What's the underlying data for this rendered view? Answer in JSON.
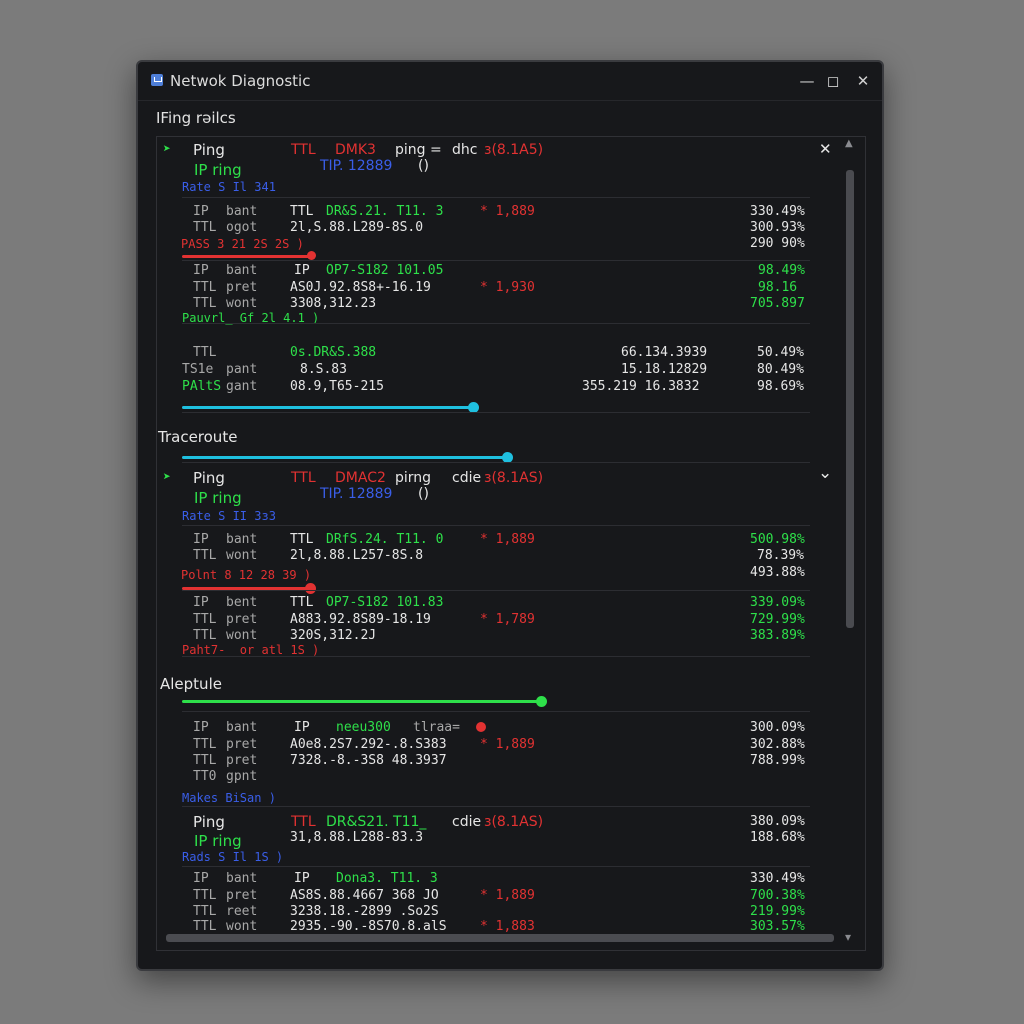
{
  "window": {
    "title": "Netwok Diagnostic",
    "minimize": "—",
    "maximize": "◻",
    "close": "✕"
  },
  "sections": {
    "ping_results": "IFing rəilcs",
    "traceroute": "Traceroute",
    "replies": "Aleptule"
  },
  "panel_controls": {
    "close": "✕",
    "expand": "⌄",
    "scroll_down": "▾"
  },
  "block1": {
    "header": {
      "label": "Ping",
      "ttl": "TTL",
      "dms": "DMK3",
      "ping": "ping =",
      "dhc": "dhc",
      "time": "ɜ(8.1A5)",
      "ip_ring": "IP ring",
      "tip": "TIP. 12889",
      "paren": "()",
      "rate": "Rate S Il 341"
    },
    "rows_a": [
      {
        "k": "IP",
        "s": "bant",
        "v1": "TTL",
        "v2": "DR&S.21. T11. 3",
        "v3": "* 1,889",
        "pct": "330.49%"
      },
      {
        "k": "TTL",
        "s": "ogot",
        "v1": "2l,S.88.L289-8S.0",
        "v2": "",
        "v3": "",
        "pct": "300.93%"
      }
    ],
    "bar_label_a": "PASS 3 21 2S 2S )",
    "pct_extra": "290 90%",
    "rows_b": [
      {
        "k": "IP",
        "s": "bant",
        "v1": "IP",
        "v2": "OP7-S182 101.05",
        "v3": "",
        "pct": "98.49%"
      },
      {
        "k": "TTL",
        "s": "pret",
        "v1": "AS0J.92.8S8+-16.19",
        "v2": "",
        "v3": "* 1,930",
        "pct": "98.16"
      },
      {
        "k": "TTL",
        "s": "wont",
        "v1": "3308,312.23",
        "v2": "",
        "v3": "",
        "pct": "705.897"
      }
    ],
    "bar_label_b": "Pauvrl_ Gf 2l 4.1 )"
  },
  "block2": {
    "rows": [
      {
        "k": "TTL",
        "s": "",
        "v1": "0s.DR&S.388",
        "mid": "66.134.3939",
        "pct": "50.49%"
      },
      {
        "k": "TS1e",
        "s": "pant",
        "v1": "8.S.83",
        "mid": "15.18.12829",
        "pct": "80.49%"
      },
      {
        "k": "PAltS",
        "s": "gant",
        "v1": "08.9,T65-215",
        "mid": "355.219 16.3832",
        "pct": "98.69%"
      }
    ]
  },
  "block3": {
    "header": {
      "label": "Ping",
      "ttl": "TTL",
      "dms": "DMAC2",
      "ping": "pirng",
      "dhc": "cdie",
      "time": "ɜ(8.1AS)",
      "ip_ring": "IP ring",
      "tip": "TIP. 12889",
      "paren": "()",
      "rate": "Rate S II 3ɜ3"
    },
    "rows_a": [
      {
        "k": "IP",
        "s": "bant",
        "v1": "TTL",
        "v2": "DRfS.24. T11. 0",
        "v3": "* 1,889",
        "pct": "500.98%"
      },
      {
        "k": "TTL",
        "s": "wont",
        "v1": "2l,8.88.L257-8S.8",
        "v2": "",
        "v3": "",
        "pct": "78.39%"
      }
    ],
    "bar_label_a": "Polnt 8 12 28 39 )",
    "pct_extra": "493.88%",
    "rows_b": [
      {
        "k": "IP",
        "s": "bent",
        "v1": "TTL",
        "v2": "OP7-S182 101.83",
        "v3": "",
        "pct": "339.09%"
      },
      {
        "k": "TTL",
        "s": "pret",
        "v1": "A883.92.8S89-18.19",
        "v2": "",
        "v3": "* 1,789",
        "pct": "729.99%"
      },
      {
        "k": "TTL",
        "s": "wont",
        "v1": "320S,312.2J",
        "v2": "",
        "v3": "",
        "pct": "383.89%"
      }
    ],
    "bar_label_b": "Paht7-_ or atl 1S )"
  },
  "block4": {
    "rows": [
      {
        "k": "IP",
        "s": "bant",
        "v1": "IP",
        "v2": "neeu300",
        "v3": "tlraa=",
        "pct": "300.09%"
      },
      {
        "k": "TTL",
        "s": "pret",
        "v1": "A0e8.2S7.292-.8.S383",
        "v2": "",
        "v3": "* 1,889",
        "pct": "302.88%"
      },
      {
        "k": "TTL",
        "s": "pret",
        "v1": "7328.-8.-3S8 48.3937",
        "v2": "",
        "v3": "",
        "pct": "788.99%"
      },
      {
        "k": "TT0",
        "s": "gpnt",
        "v1": "",
        "v2": "",
        "v3": "",
        "pct": ""
      }
    ],
    "bar_label": "Makes BiSan )"
  },
  "block5": {
    "header": {
      "label": "Ping",
      "ttl": "TTL",
      "dms": "DR&S21. T11_",
      "dhc": "cdie",
      "time": "ɜ(8.1AS)",
      "ip_ring": "IP ring",
      "ip_val": "31,8.88.L288-83.3",
      "rate": "Rads S Il 1S )",
      "pct1": "380.09%",
      "pct2": "188.68%"
    },
    "rows": [
      {
        "k": "IP",
        "s": "bant",
        "v1": "IP",
        "v2": "Dona3. T11. 3",
        "v3": "",
        "pct": "330.49%"
      },
      {
        "k": "TTL",
        "s": "pret",
        "v1": "AS8S.88.4667 368 JO",
        "v2": "",
        "v3": "* 1,889",
        "pct": "700.38%"
      },
      {
        "k": "TTL",
        "s": "reet",
        "v1": "3238.18.-2899 .So2S",
        "v2": "",
        "v3": "",
        "pct": "219.99%"
      },
      {
        "k": "TTL",
        "s": "wont",
        "v1": "2935.-90.-8S70.8.alS",
        "v2": "",
        "v3": "* 1,883",
        "pct": "303.57%"
      }
    ]
  },
  "colors": {
    "green": "#2ee04a",
    "red": "#e23232",
    "blue": "#3a5ee8",
    "cyan": "#1fc0e0",
    "background": "#17181b"
  }
}
